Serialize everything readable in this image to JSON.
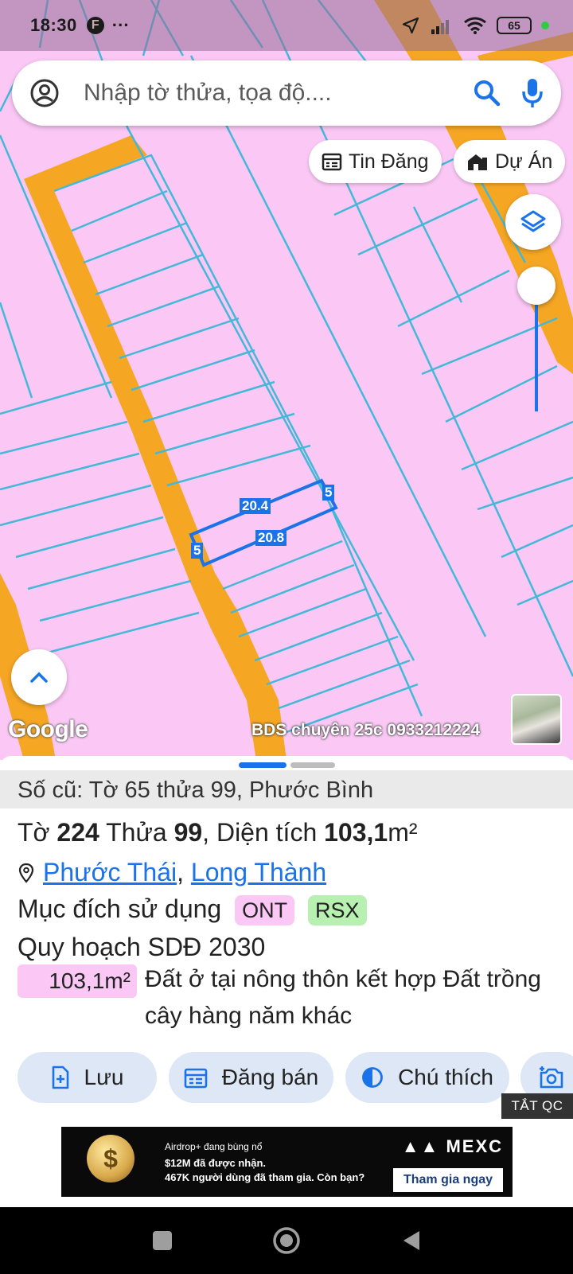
{
  "status_bar": {
    "time": "18:30",
    "app_icon": "F",
    "more": "···",
    "battery": "65"
  },
  "search": {
    "placeholder": "Nhập tờ thửa, tọa độ...."
  },
  "chips": {
    "news": "Tin Đăng",
    "projects": "Dự Án"
  },
  "map": {
    "google_label": "Google",
    "watermark": "BDS chuyên 25c 0933212224",
    "dims": {
      "top": "20.4",
      "bottom": "20.8",
      "right": "5",
      "left": "5"
    },
    "colors": {
      "land": "#fbc8f5",
      "road": "#f5a623",
      "lot_line": "#44b8d8",
      "highlight": "#1a73e8"
    }
  },
  "parcel": {
    "old_info": "Số cũ: Tờ 65 thửa 99, Phước Bình",
    "sheet_label": "Tờ",
    "sheet_no": "224",
    "plot_label": "Thửa",
    "plot_no": "99",
    "area_label": ", Diện tích",
    "area_value": "103,1",
    "area_unit": "m²",
    "ward": "Phước Thái",
    "district": "Long Thành",
    "purpose_label": "Mục đích sử dụng",
    "purpose_tags": [
      "ONT",
      "RSX"
    ],
    "plan_label": "Quy hoạch SDĐ 2030",
    "plan_area": "103,1m²",
    "plan_desc": "Đất ở tại nông thôn kết hợp Đất trồng cây hàng năm khác"
  },
  "actions": {
    "save": "Lưu",
    "sell": "Đăng bán",
    "legend": "Chú thích"
  },
  "ad": {
    "hide_label": "TẮT QC",
    "line1": "Airdrop+ đang bùng nổ",
    "line2": "$12M đã được nhận.",
    "line3": "467K người dùng đã tham gia. Còn bạn?",
    "brand": "MEXC",
    "cta": "Tham gia ngay"
  }
}
